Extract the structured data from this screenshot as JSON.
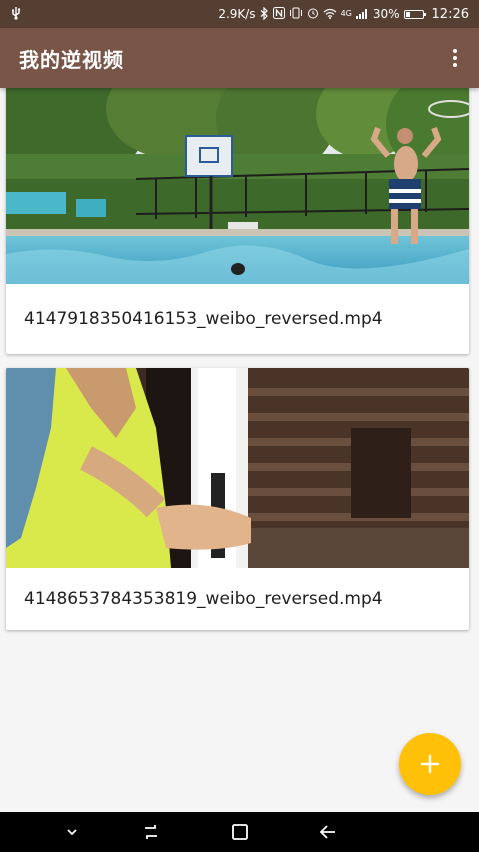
{
  "status_bar": {
    "network_speed": "2.9K/s",
    "network_type": "4G",
    "battery_percent": "30%",
    "battery_level": 0.3,
    "time": "12:26",
    "icons": [
      "usb-icon",
      "bluetooth-icon",
      "nfc-icon",
      "vibrate-icon",
      "alarm-icon",
      "wifi-icon",
      "signal-icon",
      "battery-icon"
    ]
  },
  "app_bar": {
    "title": "我的逆视频",
    "menu_icon": "more-vert-icon"
  },
  "videos": [
    {
      "filename": "4147918350416153_weibo_reversed.mp4"
    },
    {
      "filename": "4148653784353819_weibo_reversed.mp4"
    }
  ],
  "fab": {
    "icon": "plus-icon",
    "color": "#ffc107"
  },
  "nav_bar": {
    "icons": [
      "chevron-down-icon",
      "recent-apps-icon",
      "home-icon",
      "back-icon"
    ]
  },
  "colors": {
    "primary": "#795548",
    "primary_dark": "#553f33",
    "accent": "#ffc107"
  }
}
